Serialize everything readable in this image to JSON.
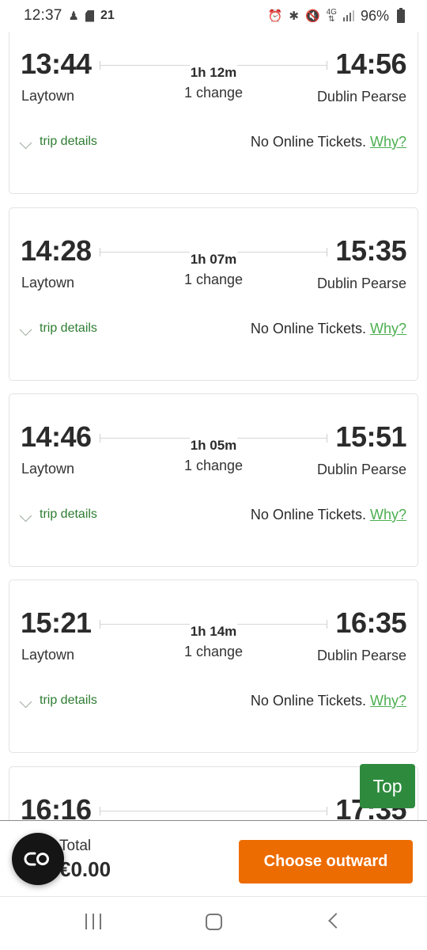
{
  "status_bar": {
    "time": "12:37",
    "notification_count": "21",
    "battery": "96%",
    "network": "4G",
    "icons": [
      "person-icon",
      "sdcard-icon",
      "alarm-icon",
      "bluetooth-icon",
      "mute-icon",
      "4g-icon",
      "signal-icon",
      "battery-icon"
    ]
  },
  "journeys": [
    {
      "departure_time": "13:44",
      "departure_station": "Laytown",
      "duration": "1h 12m",
      "changes": "1 change",
      "arrival_time": "14:56",
      "arrival_station": "Dublin Pearse",
      "details_label": "trip details",
      "ticket_note": "No Online Tickets.",
      "why_label": "Why?"
    },
    {
      "departure_time": "14:28",
      "departure_station": "Laytown",
      "duration": "1h 07m",
      "changes": "1 change",
      "arrival_time": "15:35",
      "arrival_station": "Dublin Pearse",
      "details_label": "trip details",
      "ticket_note": "No Online Tickets.",
      "why_label": "Why?"
    },
    {
      "departure_time": "14:46",
      "departure_station": "Laytown",
      "duration": "1h 05m",
      "changes": "1 change",
      "arrival_time": "15:51",
      "arrival_station": "Dublin Pearse",
      "details_label": "trip details",
      "ticket_note": "No Online Tickets.",
      "why_label": "Why?"
    },
    {
      "departure_time": "15:21",
      "departure_station": "Laytown",
      "duration": "1h 14m",
      "changes": "1 change",
      "arrival_time": "16:35",
      "arrival_station": "Dublin Pearse",
      "details_label": "trip details",
      "ticket_note": "No Online Tickets.",
      "why_label": "Why?"
    },
    {
      "departure_time": "16:16",
      "departure_station": "",
      "duration": "",
      "changes": "",
      "arrival_time": "17:35",
      "arrival_station": "",
      "details_label": "",
      "ticket_note": "",
      "why_label": ""
    }
  ],
  "top_button": {
    "label": "Top"
  },
  "footer": {
    "total_label": "Total",
    "total_value": "€0.00",
    "choose_button": "Choose outward"
  },
  "colors": {
    "primary_orange": "#ed6c02",
    "green_dark": "#2e7d32",
    "green_link": "#4caf50",
    "top_button_green": "#2e8b3e"
  },
  "nav_bar": {
    "buttons": [
      "recents",
      "home",
      "back"
    ]
  }
}
